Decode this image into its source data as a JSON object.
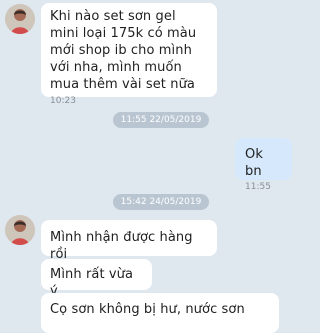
{
  "messages": [
    {
      "text": "Khi nào set sơn gel mini loại 175k có màu mới shop ib cho mình với nha, mình muốn mua thêm vài set nữa",
      "time": "10:23"
    },
    {
      "text": "Ok bn",
      "time": "11:55"
    },
    {
      "text": "Mình nhận được hàng rồi"
    },
    {
      "text": "Mình rất vừa ý"
    },
    {
      "text": "Cọ sơn không bị hư, nước sơn"
    }
  ],
  "dates": {
    "first": "11:55 22/05/2019",
    "second": "15:42 24/05/2019"
  },
  "colors": {
    "background": "#dfe7ef",
    "incoming_bubble": "#ffffff",
    "outgoing_bubble": "#d6e8fb",
    "date_pill": "#b9c5d1"
  }
}
